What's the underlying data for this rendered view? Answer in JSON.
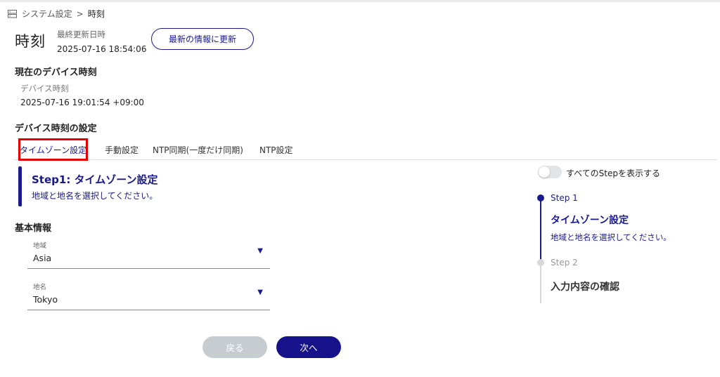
{
  "breadcrumb": {
    "icon": "server-icon",
    "parent": "システム設定",
    "separator": ">",
    "current": "時刻"
  },
  "header": {
    "title": "時刻",
    "updated_label": "最終更新日時",
    "updated_value": "2025-07-16 18:54:06",
    "refresh_button": "最新の情報に更新"
  },
  "device_time": {
    "heading": "現在のデバイス時刻",
    "label": "デバイス時刻",
    "value": "2025-07-16 19:01:54 +09:00"
  },
  "settings": {
    "heading": "デバイス時刻の設定",
    "tabs": [
      {
        "label": "タイムゾーン設定",
        "active": true
      },
      {
        "label": "手動設定",
        "active": false
      },
      {
        "label": "NTP同期(一度だけ同期)",
        "active": false
      },
      {
        "label": "NTP設定",
        "active": false
      }
    ]
  },
  "step": {
    "title": "Step1: タイムゾーン設定",
    "description": "地域と地名を選択してください。"
  },
  "basic_info": {
    "heading": "基本情報",
    "region": {
      "label": "地域",
      "value": "Asia",
      "arrow_icon": "triangle-down-icon"
    },
    "place": {
      "label": "地名",
      "value": "Tokyo",
      "arrow_icon": "triangle-down-icon"
    }
  },
  "buttons": {
    "back": "戻る",
    "next": "次へ"
  },
  "stepper": {
    "toggle_label": "すべてのStepを表示する",
    "toggle_on": false,
    "steps": [
      {
        "label": "Step 1",
        "title": "タイムゾーン設定",
        "description": "地域と地名を選択してください。",
        "active": true
      },
      {
        "label": "Step 2",
        "title": "入力内容の確認",
        "active": false
      }
    ]
  },
  "colors": {
    "accent": "#1a1a8c",
    "highlight": "#e00000",
    "disabled_button": "#c7ccd0"
  }
}
